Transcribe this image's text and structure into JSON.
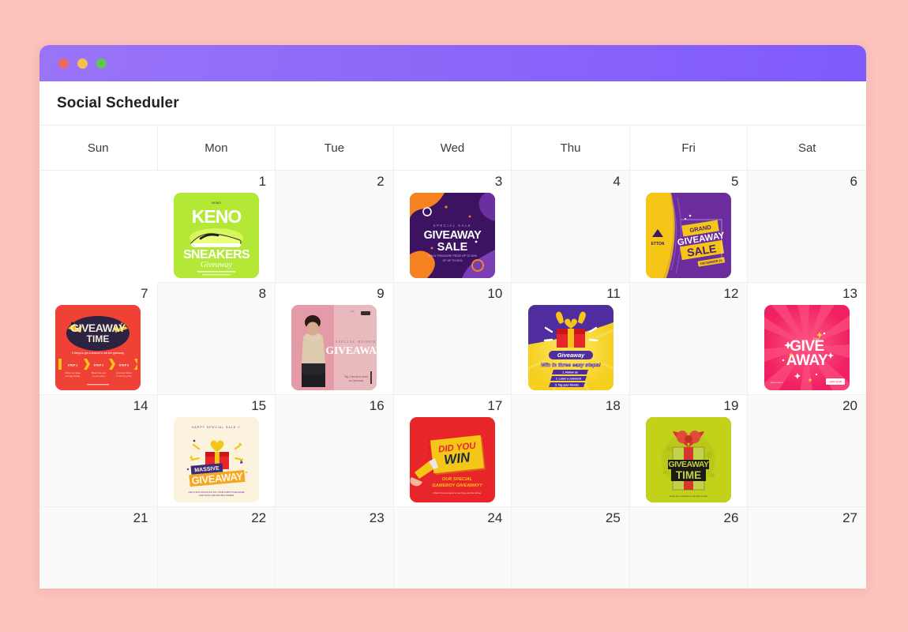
{
  "window": {
    "traffic_lights": [
      "close",
      "minimize",
      "maximize"
    ],
    "title_bar_gradient_from": "#9a74f7",
    "title_bar_gradient_to": "#7f5afc"
  },
  "app": {
    "title": "Social Scheduler"
  },
  "page": {
    "background_color": "#fdc2bc"
  },
  "calendar": {
    "weekdays": [
      "Sun",
      "Mon",
      "Tue",
      "Wed",
      "Thu",
      "Fri",
      "Sat"
    ],
    "cells": [
      {
        "date": "",
        "blank": true,
        "post": null
      },
      {
        "date": "1",
        "blank": false,
        "post": {
          "id": "keno-sneakers-giveaway",
          "bg": "#b4e837",
          "lines": [
            "KENO",
            "SNEAKERS",
            "Giveaway"
          ]
        }
      },
      {
        "date": "2",
        "blank": false,
        "post": null
      },
      {
        "date": "3",
        "blank": false,
        "post": {
          "id": "giveaway-sale-blob",
          "bg": "#3c1361",
          "lines": [
            "GIVEAWAY",
            "SALE"
          ]
        }
      },
      {
        "date": "4",
        "blank": false,
        "post": null
      },
      {
        "date": "5",
        "blank": false,
        "post": {
          "id": "grand-giveaway-sale",
          "bg": "#f5c518",
          "lines": [
            "GRAND",
            "GIVEAWAY",
            "SALE"
          ]
        }
      },
      {
        "date": "6",
        "blank": false,
        "post": null
      },
      {
        "date": "7",
        "blank": false,
        "post": {
          "id": "giveaway-time-steps",
          "bg": "#ef4136",
          "lines": [
            "GIVEAWAY",
            "TIME",
            "STEP 1",
            "STEP 2",
            "STEP 3"
          ]
        }
      },
      {
        "date": "8",
        "blank": false,
        "post": null
      },
      {
        "date": "9",
        "blank": false,
        "post": {
          "id": "special-hoodie-giveaway",
          "bg": "#e8b9bd",
          "lines": [
            "SPECIAL HOODIE",
            "GIVEAWAY"
          ]
        }
      },
      {
        "date": "10",
        "blank": false,
        "post": null
      },
      {
        "date": "11",
        "blank": false,
        "post": {
          "id": "giveaway-three-steps",
          "bg": "#f5d020",
          "lines": [
            "Giveaway",
            "Win in three easy steps!"
          ]
        }
      },
      {
        "date": "12",
        "blank": false,
        "post": null
      },
      {
        "date": "13",
        "blank": false,
        "post": {
          "id": "give-away-sunburst",
          "bg": "#f6386e",
          "lines": [
            "GIVE",
            "AWAY"
          ]
        }
      },
      {
        "date": "14",
        "blank": false,
        "post": null
      },
      {
        "date": "15",
        "blank": false,
        "post": {
          "id": "massive-giveaway-gift",
          "bg": "#fbf3dd",
          "lines": [
            "MASSIVE",
            "GIVEAWAY"
          ]
        }
      },
      {
        "date": "16",
        "blank": false,
        "post": null
      },
      {
        "date": "17",
        "blank": false,
        "post": {
          "id": "did-you-win-megaphone",
          "bg": "#e8262a",
          "lines": [
            "DID YOU",
            "WIN",
            "OUR SPECIAL GAMEBOY GIVEAWAY?"
          ]
        }
      },
      {
        "date": "18",
        "blank": false,
        "post": null
      },
      {
        "date": "19",
        "blank": false,
        "post": {
          "id": "giveaway-time-gift",
          "bg": "#c2d11a",
          "lines": [
            "GIVEAWAY",
            "TIME"
          ]
        }
      },
      {
        "date": "20",
        "blank": false,
        "post": null
      },
      {
        "date": "21",
        "blank": false,
        "post": null
      },
      {
        "date": "22",
        "blank": false,
        "post": null
      },
      {
        "date": "23",
        "blank": false,
        "post": null
      },
      {
        "date": "24",
        "blank": false,
        "post": null
      },
      {
        "date": "25",
        "blank": false,
        "post": null
      },
      {
        "date": "26",
        "blank": false,
        "post": null
      },
      {
        "date": "27",
        "blank": false,
        "post": null
      }
    ]
  }
}
